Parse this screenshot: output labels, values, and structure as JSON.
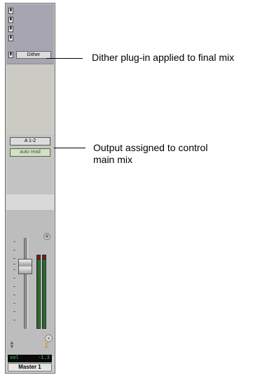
{
  "channel_strip": {
    "inserts": [
      "",
      "",
      "",
      "",
      "Dither"
    ],
    "output": "A 1-2",
    "automation_mode": "auto read",
    "volume": {
      "label": "vol",
      "value": "-1.3"
    },
    "name": "Master 1"
  },
  "callouts": {
    "dither": "Dither plug-in applied to final mix",
    "output": "Output assigned to control main mix"
  },
  "icons": {
    "insert_spin": "up-down-arrows-icon",
    "pan": "pan-knob-icon",
    "group": "group-knob-icon",
    "automation": "automation-icon"
  }
}
